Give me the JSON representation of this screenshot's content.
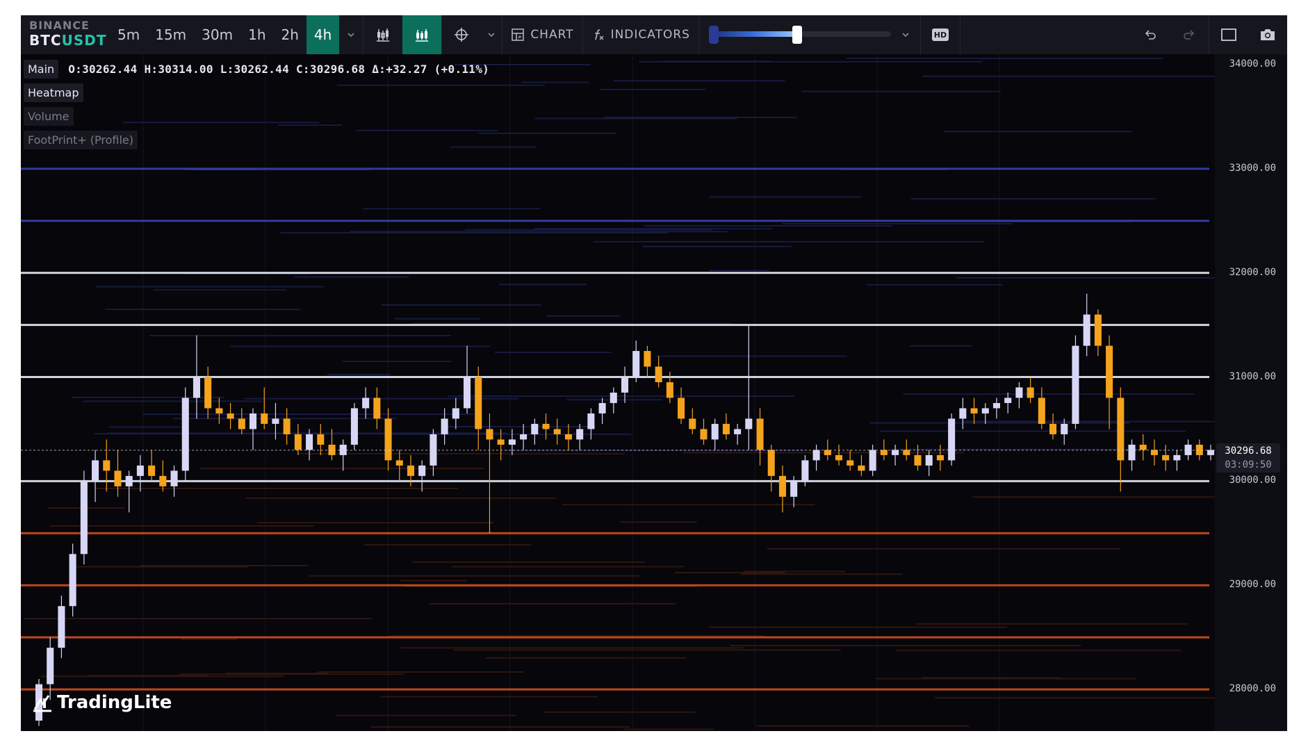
{
  "toolbar": {
    "exchange": "BINANCE",
    "pair_base": "BTC",
    "pair_quote": "USDT",
    "timeframes": [
      "5m",
      "15m",
      "30m",
      "1h",
      "2h",
      "4h"
    ],
    "active_timeframe": "4h",
    "chart_label": "CHART",
    "indicators_label": "INDICATORS",
    "hd_label": "HD",
    "heatmap_intensity": 0.48
  },
  "legend": {
    "main_label": "Main",
    "ohlc": "O:30262.44 H:30314.00 L:30262.44 C:30296.68 Δ:+32.27 (+0.11%)",
    "layers": [
      "Heatmap",
      "Volume",
      "FootPrint+ (Profile)"
    ]
  },
  "axis": {
    "ticks": [
      "34000.00",
      "33000.00",
      "32000.00",
      "31000.00",
      "30000.00",
      "29000.00",
      "28000.00"
    ],
    "current_price": "30296.68",
    "countdown": "03:09:50"
  },
  "logo_text": "TradingLite",
  "colors": {
    "up": "#d7d7f5",
    "down": "#f5a21c",
    "accent": "#0c6f5c",
    "quote": "#25c2a9"
  },
  "chart_data": {
    "type": "candlestick",
    "symbol": "BTCUSDT",
    "timeframe": "4h",
    "ylim": [
      27600,
      34100
    ],
    "yticks": [
      28000,
      29000,
      30000,
      31000,
      32000,
      33000,
      34000
    ],
    "last_price": 30296.68,
    "candles": [
      [
        27700,
        28100,
        27650,
        28050
      ],
      [
        28050,
        28500,
        27900,
        28400
      ],
      [
        28400,
        28900,
        28300,
        28800
      ],
      [
        28800,
        29400,
        28700,
        29300
      ],
      [
        29300,
        30100,
        29200,
        30000
      ],
      [
        30000,
        30300,
        29800,
        30200
      ],
      [
        30200,
        30400,
        29900,
        30100
      ],
      [
        30100,
        30300,
        29850,
        29950
      ],
      [
        29950,
        30100,
        29700,
        30050
      ],
      [
        30050,
        30250,
        29900,
        30150
      ],
      [
        30150,
        30300,
        30000,
        30050
      ],
      [
        30050,
        30200,
        29900,
        29950
      ],
      [
        29950,
        30150,
        29850,
        30100
      ],
      [
        30100,
        30900,
        30000,
        30800
      ],
      [
        30800,
        31400,
        30600,
        31000
      ],
      [
        31000,
        31100,
        30600,
        30700
      ],
      [
        30700,
        30800,
        30550,
        30650
      ],
      [
        30650,
        30750,
        30500,
        30600
      ],
      [
        30600,
        30700,
        30450,
        30500
      ],
      [
        30500,
        30700,
        30300,
        30650
      ],
      [
        30650,
        30900,
        30500,
        30550
      ],
      [
        30550,
        30750,
        30400,
        30600
      ],
      [
        30600,
        30700,
        30350,
        30450
      ],
      [
        30450,
        30550,
        30250,
        30300
      ],
      [
        30300,
        30500,
        30200,
        30450
      ],
      [
        30450,
        30550,
        30250,
        30350
      ],
      [
        30350,
        30500,
        30200,
        30250
      ],
      [
        30250,
        30400,
        30100,
        30350
      ],
      [
        30350,
        30750,
        30300,
        30700
      ],
      [
        30700,
        30900,
        30600,
        30800
      ],
      [
        30800,
        30900,
        30500,
        30600
      ],
      [
        30600,
        30700,
        30100,
        30200
      ],
      [
        30200,
        30300,
        30000,
        30150
      ],
      [
        30150,
        30250,
        29950,
        30050
      ],
      [
        30050,
        30200,
        29900,
        30150
      ],
      [
        30150,
        30500,
        30050,
        30450
      ],
      [
        30450,
        30700,
        30350,
        30600
      ],
      [
        30600,
        30800,
        30500,
        30700
      ],
      [
        30700,
        31300,
        30650,
        31000
      ],
      [
        31000,
        31100,
        30300,
        30500
      ],
      [
        30500,
        30650,
        29500,
        30400
      ],
      [
        30400,
        30500,
        30200,
        30350
      ],
      [
        30350,
        30500,
        30250,
        30400
      ],
      [
        30400,
        30550,
        30300,
        30450
      ],
      [
        30450,
        30600,
        30350,
        30550
      ],
      [
        30550,
        30650,
        30400,
        30500
      ],
      [
        30500,
        30600,
        30350,
        30450
      ],
      [
        30450,
        30550,
        30300,
        30400
      ],
      [
        30400,
        30550,
        30300,
        30500
      ],
      [
        30500,
        30700,
        30400,
        30650
      ],
      [
        30650,
        30800,
        30550,
        30750
      ],
      [
        30750,
        30900,
        30650,
        30850
      ],
      [
        30850,
        31100,
        30750,
        31000
      ],
      [
        31000,
        31350,
        30950,
        31250
      ],
      [
        31250,
        31300,
        31000,
        31100
      ],
      [
        31100,
        31200,
        30900,
        30950
      ],
      [
        30950,
        31050,
        30750,
        30800
      ],
      [
        30800,
        30900,
        30550,
        30600
      ],
      [
        30600,
        30700,
        30450,
        30500
      ],
      [
        30500,
        30600,
        30350,
        30400
      ],
      [
        30400,
        30600,
        30300,
        30550
      ],
      [
        30550,
        30650,
        30400,
        30450
      ],
      [
        30450,
        30550,
        30350,
        30500
      ],
      [
        30500,
        31500,
        30300,
        30600
      ],
      [
        30600,
        30700,
        30150,
        30300
      ],
      [
        30300,
        30350,
        29900,
        30050
      ],
      [
        30050,
        30150,
        29700,
        29850
      ],
      [
        29850,
        30050,
        29750,
        30000
      ],
      [
        30000,
        30250,
        29950,
        30200
      ],
      [
        30200,
        30350,
        30100,
        30300
      ],
      [
        30300,
        30400,
        30200,
        30250
      ],
      [
        30250,
        30350,
        30150,
        30200
      ],
      [
        30200,
        30300,
        30100,
        30150
      ],
      [
        30150,
        30250,
        30050,
        30100
      ],
      [
        30100,
        30350,
        30050,
        30300
      ],
      [
        30300,
        30400,
        30200,
        30250
      ],
      [
        30250,
        30350,
        30150,
        30300
      ],
      [
        30300,
        30400,
        30200,
        30250
      ],
      [
        30250,
        30350,
        30100,
        30150
      ],
      [
        30150,
        30300,
        30050,
        30250
      ],
      [
        30250,
        30350,
        30100,
        30200
      ],
      [
        30200,
        30650,
        30150,
        30600
      ],
      [
        30600,
        30800,
        30500,
        30700
      ],
      [
        30700,
        30800,
        30550,
        30650
      ],
      [
        30650,
        30750,
        30550,
        30700
      ],
      [
        30700,
        30800,
        30600,
        30750
      ],
      [
        30750,
        30850,
        30650,
        30800
      ],
      [
        30800,
        30950,
        30700,
        30900
      ],
      [
        30900,
        31000,
        30750,
        30800
      ],
      [
        30800,
        30900,
        30500,
        30550
      ],
      [
        30550,
        30650,
        30400,
        30450
      ],
      [
        30450,
        30600,
        30350,
        30550
      ],
      [
        30550,
        31400,
        30500,
        31300
      ],
      [
        31300,
        31800,
        31200,
        31600
      ],
      [
        31600,
        31650,
        31200,
        31300
      ],
      [
        31300,
        31400,
        30500,
        30800
      ],
      [
        30800,
        30900,
        29900,
        30200
      ],
      [
        30200,
        30400,
        30100,
        30350
      ],
      [
        30350,
        30450,
        30200,
        30300
      ],
      [
        30300,
        30400,
        30150,
        30250
      ],
      [
        30250,
        30350,
        30100,
        30200
      ],
      [
        30200,
        30300,
        30100,
        30250
      ],
      [
        30250,
        30400,
        30200,
        30350
      ],
      [
        30350,
        30400,
        30200,
        30250
      ],
      [
        30250,
        30350,
        30200,
        30300
      ]
    ],
    "heatmap_levels": [
      {
        "price": 33000,
        "color": "blue"
      },
      {
        "price": 32500,
        "color": "blue"
      },
      {
        "price": 32000,
        "color": "white"
      },
      {
        "price": 31500,
        "color": "white"
      },
      {
        "price": 31000,
        "color": "white"
      },
      {
        "price": 30000,
        "color": "white"
      },
      {
        "price": 29500,
        "color": "orange"
      },
      {
        "price": 29000,
        "color": "orange"
      },
      {
        "price": 28500,
        "color": "orange"
      },
      {
        "price": 28000,
        "color": "orange"
      }
    ]
  }
}
